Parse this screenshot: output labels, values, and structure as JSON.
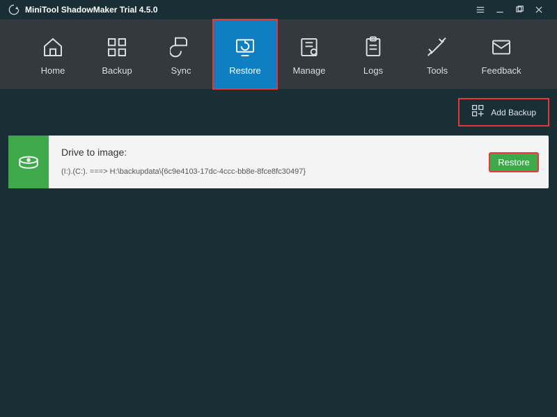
{
  "app": {
    "title": "MiniTool ShadowMaker Trial 4.5.0"
  },
  "nav": {
    "items": [
      {
        "label": "Home"
      },
      {
        "label": "Backup"
      },
      {
        "label": "Sync"
      },
      {
        "label": "Restore"
      },
      {
        "label": "Manage"
      },
      {
        "label": "Logs"
      },
      {
        "label": "Tools"
      },
      {
        "label": "Feedback"
      }
    ],
    "active_index": 3
  },
  "actions": {
    "add_backup": "Add Backup"
  },
  "task": {
    "title": "Drive to image:",
    "path": "(I:).(C:). ===> H:\\backupdata\\{6c9e4103-17dc-4ccc-bb8e-8fce8fc30497}",
    "restore_label": "Restore"
  },
  "colors": {
    "accent": "#0f7fc2",
    "green": "#3ea94a",
    "highlight": "#e53935",
    "bg": "#1a2f35",
    "navbg": "#323a40"
  }
}
